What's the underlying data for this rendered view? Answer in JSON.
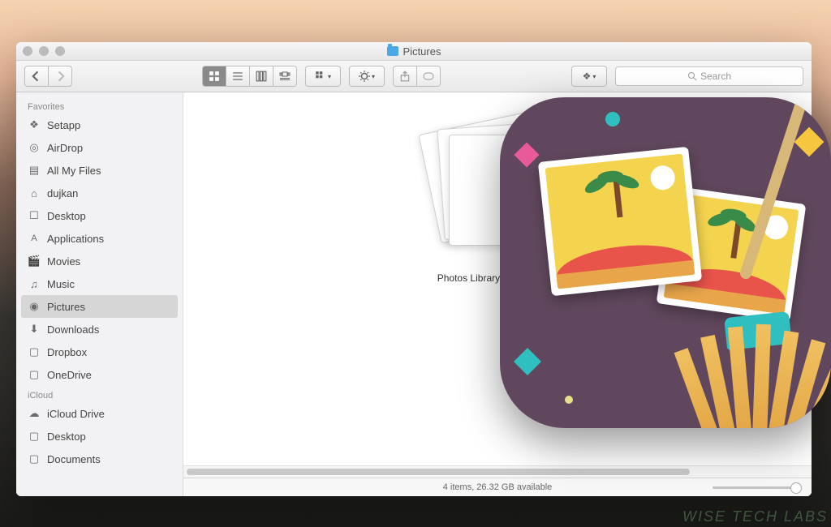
{
  "window": {
    "title": "Pictures"
  },
  "toolbar": {
    "search_placeholder": "Search"
  },
  "sidebar": {
    "sections": [
      {
        "header": "Favorites",
        "items": [
          {
            "label": "Setapp",
            "icon": "diamond-icon"
          },
          {
            "label": "AirDrop",
            "icon": "airdrop-icon"
          },
          {
            "label": "All My Files",
            "icon": "allfiles-icon"
          },
          {
            "label": "dujkan",
            "icon": "home-icon"
          },
          {
            "label": "Desktop",
            "icon": "desktop-icon"
          },
          {
            "label": "Applications",
            "icon": "applications-icon"
          },
          {
            "label": "Movies",
            "icon": "movies-icon"
          },
          {
            "label": "Music",
            "icon": "music-icon"
          },
          {
            "label": "Pictures",
            "icon": "pictures-icon",
            "selected": true
          },
          {
            "label": "Downloads",
            "icon": "downloads-icon"
          },
          {
            "label": "Dropbox",
            "icon": "folder-icon"
          },
          {
            "label": "OneDrive",
            "icon": "folder-icon"
          }
        ]
      },
      {
        "header": "iCloud",
        "items": [
          {
            "label": "iCloud Drive",
            "icon": "cloud-icon"
          },
          {
            "label": "Desktop",
            "icon": "folder-icon"
          },
          {
            "label": "Documents",
            "icon": "folder-icon"
          }
        ]
      }
    ]
  },
  "files": [
    {
      "name": "Photos Library.photoslibrary"
    }
  ],
  "status": {
    "text": "4 items, 26.32 GB available"
  },
  "watermark": "WISE TECH LABS"
}
